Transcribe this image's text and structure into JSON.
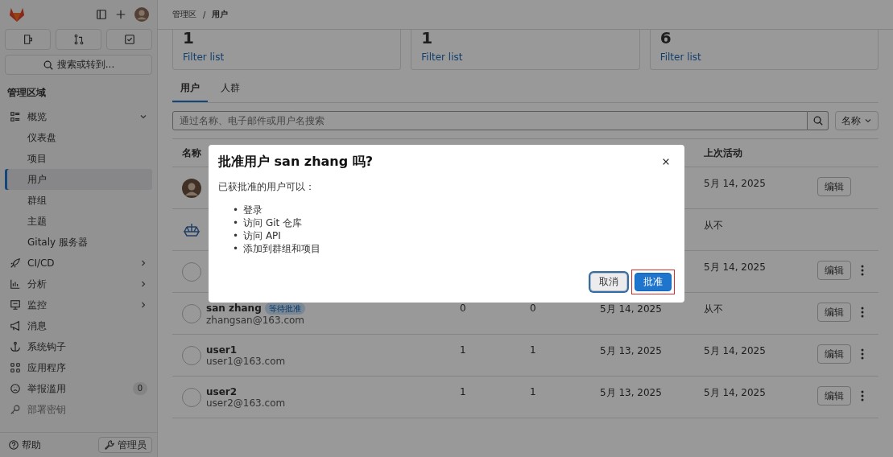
{
  "sidebar": {
    "search": "搜索或转到...",
    "section_title": "管理区域",
    "items": [
      {
        "label": "概览",
        "kind": "list",
        "expanded": true,
        "children": [
          {
            "label": "仪表盘",
            "selected": false
          },
          {
            "label": "项目",
            "selected": false
          },
          {
            "label": "用户",
            "selected": true
          },
          {
            "label": "群组",
            "selected": false
          },
          {
            "label": "主题",
            "selected": false
          },
          {
            "label": "Gitaly 服务器",
            "selected": false
          }
        ]
      },
      {
        "label": "CI/CD",
        "kind": "rocket",
        "expanded": false
      },
      {
        "label": "分析",
        "kind": "chart",
        "expanded": false
      },
      {
        "label": "监控",
        "kind": "monitor",
        "expanded": false
      },
      {
        "label": "消息",
        "kind": "megaphone"
      },
      {
        "label": "系统钩子",
        "kind": "anchor"
      },
      {
        "label": "应用程序",
        "kind": "apps"
      },
      {
        "label": "举报滥用",
        "kind": "face",
        "badge": "0"
      },
      {
        "label": "部署密钥",
        "kind": "key"
      }
    ],
    "help": "帮助",
    "admin": "管理员"
  },
  "breadcrumb": {
    "items": [
      "管理区",
      "用户"
    ],
    "separator": "/"
  },
  "stats": [
    {
      "value": "1",
      "link": "Filter list"
    },
    {
      "value": "1",
      "link": "Filter list"
    },
    {
      "value": "6",
      "link": "Filter list"
    }
  ],
  "tabs": [
    {
      "label": "用户",
      "selected": true
    },
    {
      "label": "人群",
      "selected": false
    }
  ],
  "search": {
    "placeholder": "通过名称、电子邮件或用户名搜索"
  },
  "sort": "名称",
  "table": {
    "columns": [
      "名称",
      "上次活动"
    ],
    "rows": [
      {
        "kind": "photo",
        "last_activity": "5月 14, 2025",
        "edit": "编辑",
        "menu": false
      },
      {
        "kind": "bot",
        "last_activity": "从不",
        "menu": false
      },
      {
        "kind": "blank",
        "last_activity": "5月 14, 2025",
        "edit": "编辑",
        "menu": true
      },
      {
        "kind": "blank",
        "name": "san zhang",
        "badge": "等待批准",
        "email": "zhangsan@163.com",
        "projects": "0",
        "groups": "0",
        "created": "5月 14, 2025",
        "last_activity": "从不",
        "edit": "编辑",
        "menu": true
      },
      {
        "kind": "blank",
        "name": "user1",
        "email": "user1@163.com",
        "projects": "1",
        "groups": "1",
        "created": "5月 13, 2025",
        "last_activity": "5月 14, 2025",
        "edit": "编辑",
        "menu": true
      },
      {
        "kind": "blank",
        "name": "user2",
        "email": "user2@163.com",
        "projects": "1",
        "groups": "1",
        "created": "5月 13, 2025",
        "last_activity": "5月 14, 2025",
        "edit": "编辑",
        "menu": true
      }
    ]
  },
  "modal": {
    "title": "批准用户 san zhang 吗?",
    "intro": "已获批准的用户可以：",
    "bullet": "•",
    "abilities": [
      "登录",
      "访问 Git 仓库",
      "访问 API",
      "添加到群组和项目"
    ],
    "buttons": [
      {
        "label": "取消",
        "kind": "secondary",
        "focused": true,
        "highlighted": false
      },
      {
        "label": "批准",
        "kind": "primary",
        "focused": false,
        "highlighted": true
      }
    ]
  }
}
